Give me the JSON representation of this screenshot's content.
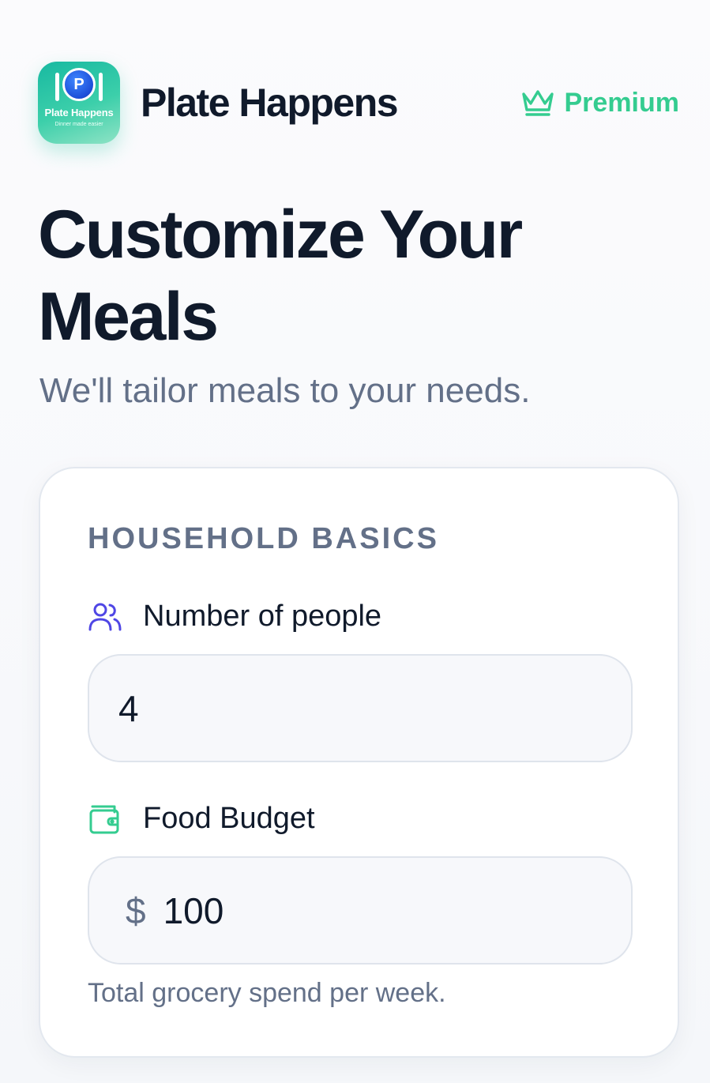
{
  "header": {
    "app_icon": {
      "badge_letter": "P",
      "title": "Plate Happens",
      "tagline": "Dinner made easier"
    },
    "brand_name": "Plate Happens",
    "premium_label": "Premium",
    "premium_icon": "crown-icon"
  },
  "main": {
    "title": "Customize Your Meals",
    "subtitle": "We'll tailor meals to your needs."
  },
  "household_basics": {
    "heading": "HOUSEHOLD BASICS",
    "people": {
      "icon": "users-icon",
      "label": "Number of people",
      "value": "4"
    },
    "budget": {
      "icon": "wallet-icon",
      "label": "Food Budget",
      "currency_symbol": "$",
      "value": "100",
      "helper": "Total grocery spend per week."
    }
  },
  "colors": {
    "accent_green": "#34cc90",
    "accent_indigo": "#4f46e5",
    "text_dark": "#101a2b",
    "text_muted": "#637088"
  }
}
